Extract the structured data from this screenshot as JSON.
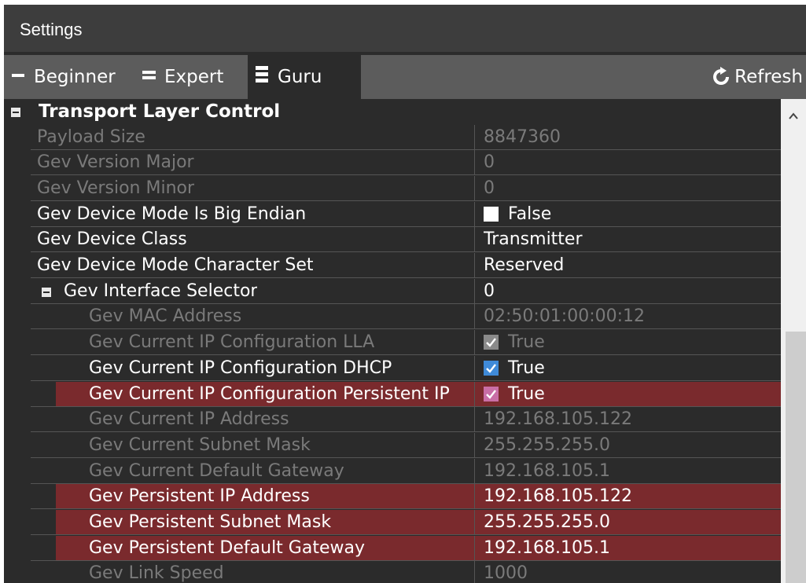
{
  "window": {
    "title": "Settings"
  },
  "toolbar": {
    "levels": [
      {
        "label": "Beginner",
        "icon": "single-bar-icon"
      },
      {
        "label": "Expert",
        "icon": "double-bar-icon"
      },
      {
        "label": "Guru",
        "icon": "triple-bar-icon",
        "selected": true
      }
    ],
    "refresh_label": "Refresh",
    "refresh_icon": "refresh-icon"
  },
  "category": {
    "name": "Transport Layer Control",
    "expand_icon": "collapse-icon"
  },
  "colors": {
    "highlight_row": "#7a2a2d",
    "enabled_text": "#ffffff",
    "disabled_text": "#7a7a7a",
    "checkbox_blue": "#3f8ad8",
    "checkbox_pink": "#c96ea6"
  },
  "properties": [
    {
      "name": "Payload Size",
      "value": "8847360",
      "enabled": false,
      "indent": 1
    },
    {
      "name": "Gev Version Major",
      "value": "0",
      "enabled": false,
      "indent": 1
    },
    {
      "name": "Gev Version Minor",
      "value": "0",
      "enabled": false,
      "indent": 1
    },
    {
      "name": "Gev Device Mode Is Big Endian",
      "value": "False",
      "checkbox": "unchecked",
      "enabled": true,
      "indent": 1
    },
    {
      "name": "Gev Device Class",
      "value": "Transmitter",
      "enabled": true,
      "indent": 1
    },
    {
      "name": "Gev Device Mode Character Set",
      "value": "Reserved",
      "enabled": true,
      "indent": 1
    },
    {
      "name": "Gev Interface Selector",
      "value": "0",
      "enabled": true,
      "indent": 1,
      "group": true
    },
    {
      "name": "Gev MAC Address",
      "value": "02:50:01:00:00:12",
      "enabled": false,
      "indent": 2
    },
    {
      "name": "Gev Current IP Configuration LLA",
      "value": "True",
      "checkbox": "checked-disabled",
      "enabled": false,
      "indent": 2
    },
    {
      "name": "Gev Current IP Configuration DHCP",
      "value": "True",
      "checkbox": "checked",
      "enabled": true,
      "indent": 2
    },
    {
      "name": "Gev Current IP Configuration Persistent IP",
      "value": "True",
      "checkbox": "checked-pink",
      "enabled": true,
      "indent": 2,
      "highlighted": true
    },
    {
      "name": "Gev Current IP Address",
      "value": "192.168.105.122",
      "enabled": false,
      "indent": 2
    },
    {
      "name": "Gev Current Subnet Mask",
      "value": "255.255.255.0",
      "enabled": false,
      "indent": 2
    },
    {
      "name": "Gev Current Default Gateway",
      "value": "192.168.105.1",
      "enabled": false,
      "indent": 2
    },
    {
      "name": "Gev Persistent IP Address",
      "value": "192.168.105.122",
      "enabled": true,
      "indent": 2,
      "highlighted": true
    },
    {
      "name": "Gev Persistent Subnet Mask",
      "value": "255.255.255.0",
      "enabled": true,
      "indent": 2,
      "highlighted": true
    },
    {
      "name": "Gev Persistent Default Gateway",
      "value": "192.168.105.1",
      "enabled": true,
      "indent": 2,
      "highlighted": true
    },
    {
      "name": "Gev Link Speed",
      "value": "1000",
      "enabled": false,
      "indent": 2
    }
  ]
}
